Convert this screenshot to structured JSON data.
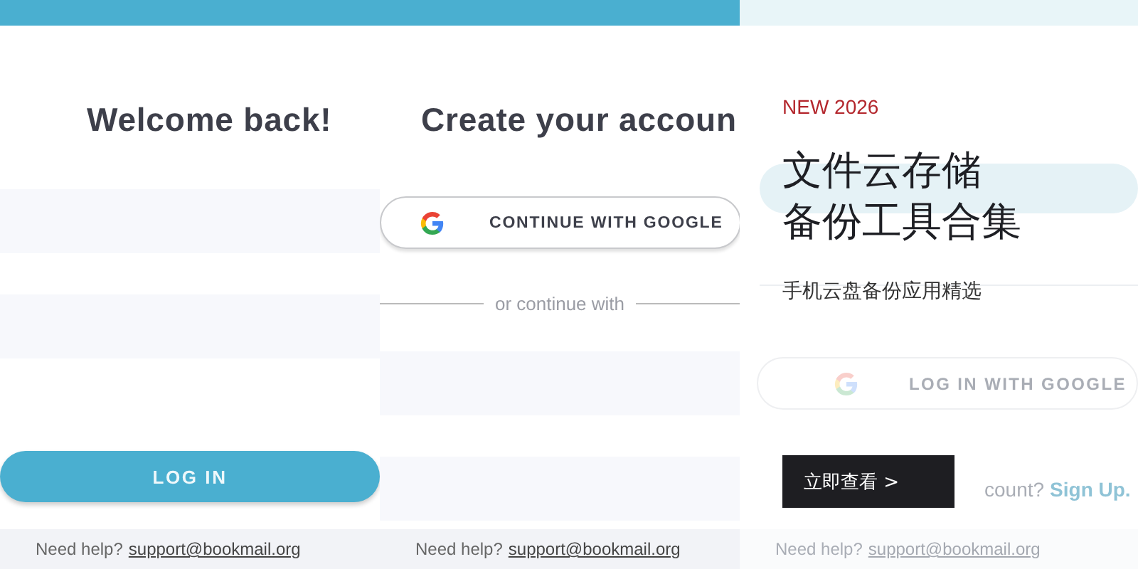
{
  "screens": [
    {
      "kind": "login",
      "title": "Welcome back!",
      "button": "LOG IN",
      "help": "Need help?",
      "help_link": "support@bookmail.org"
    },
    {
      "kind": "signup",
      "title": "Create your accoun",
      "google_button": "CONTINUE WITH GOOGLE",
      "divider": "or continue with",
      "help": "Need help?",
      "help_link": "support@bookmail.org"
    },
    {
      "kind": "login-google",
      "google_button": "LOG IN WITH GOOGLE",
      "signup_prompt": "count?",
      "signup_link": "Sign Up.",
      "help": "Need help?",
      "help_link": "support@bookmail.org"
    }
  ],
  "promo": {
    "tag": "NEW 2026",
    "title_lines": [
      "文件云存储",
      "备份工具合集"
    ],
    "subtitle": "手机云盘备份应用精选",
    "cta": "立即查看 >"
  }
}
